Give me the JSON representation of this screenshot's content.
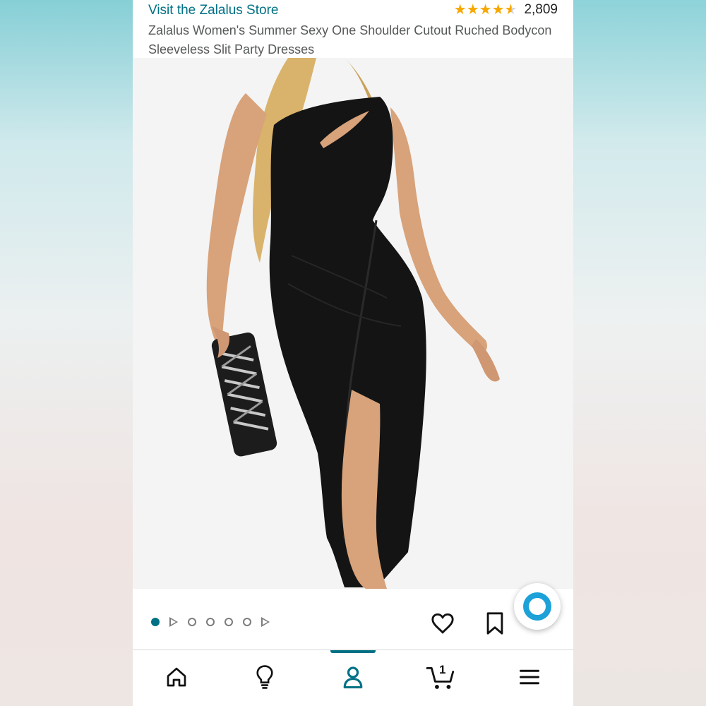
{
  "header": {
    "store_link": "Visit the Zalalus Store",
    "rating_stars": 4.5,
    "rating_count": "2,809",
    "product_title": "Zalalus Women's Summer Sexy One Shoulder Cutout Ruched Bodycon Sleeveless Slit Party Dresses"
  },
  "gallery": {
    "image_description_icon": "product-photo",
    "total_items": 7,
    "active_index": 0,
    "item_types": [
      "image",
      "video",
      "image",
      "image",
      "image",
      "image",
      "video"
    ]
  },
  "actions": {
    "wishlist_icon": "heart-icon",
    "save_icon": "bookmark-icon",
    "assistant_icon": "alexa-icon"
  },
  "bottom_nav": {
    "items": [
      {
        "icon": "home-icon"
      },
      {
        "icon": "lightbulb-icon"
      },
      {
        "icon": "user-icon"
      },
      {
        "icon": "cart-icon"
      },
      {
        "icon": "menu-icon"
      }
    ],
    "active_item": "user-icon",
    "cart_count": "1"
  },
  "colors": {
    "link": "#007185",
    "star": "#f7a800",
    "alexa": "#1ca1d8"
  }
}
